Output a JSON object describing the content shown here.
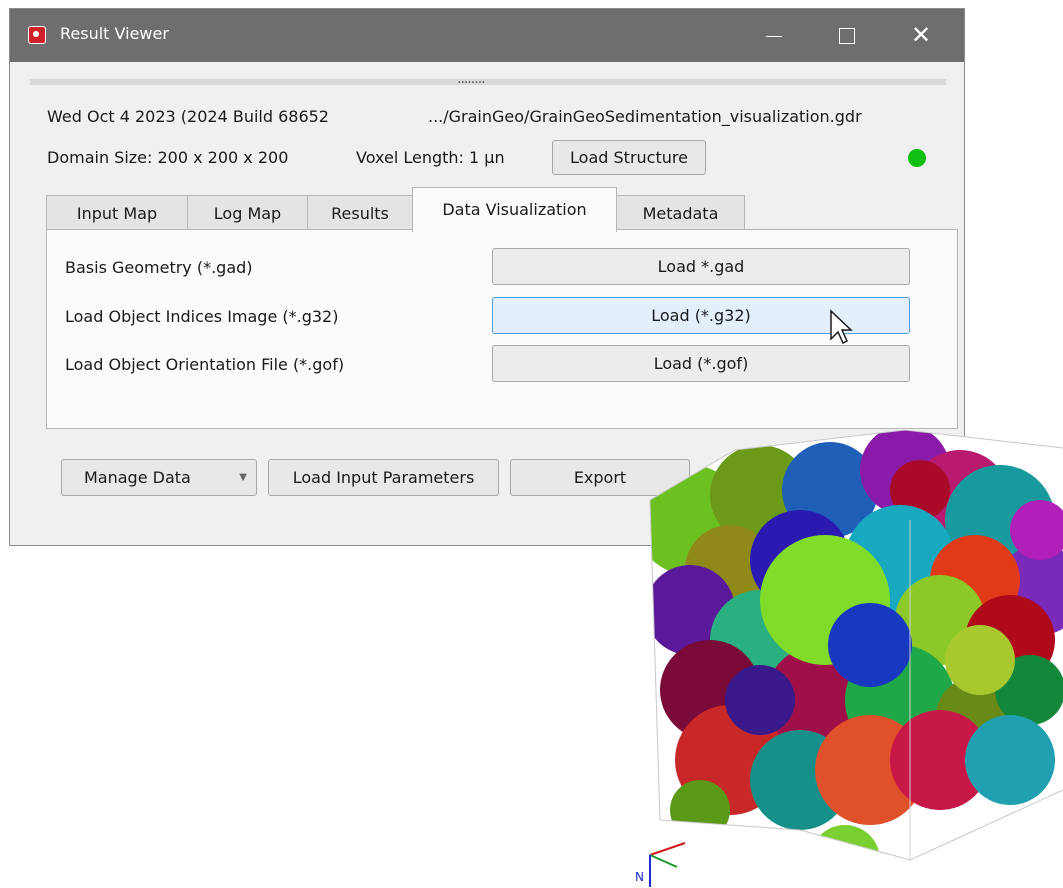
{
  "window": {
    "title": "Result Viewer",
    "controls": {
      "minimize": "minimize",
      "maximize": "maximize",
      "close": "✕"
    }
  },
  "splitter": {
    "handle": "........"
  },
  "info": {
    "build": "Wed Oct 4 2023 (2024 Build 68652",
    "file_path": ".../GrainGeo/GrainGeoSedimentation_visualization.gdr",
    "domain_size": "Domain Size: 200 x 200 x 200",
    "voxel_length": "Voxel Length: 1 µn",
    "load_structure_label": "Load Structure",
    "status_color": "#10c010"
  },
  "tabs": [
    {
      "label": "Input Map",
      "active": false
    },
    {
      "label": "Log Map",
      "active": false
    },
    {
      "label": "Results",
      "active": false
    },
    {
      "label": "Data Visualization",
      "active": true
    },
    {
      "label": "Metadata",
      "active": false
    }
  ],
  "data_visualization": {
    "rows": [
      {
        "label": "Basis Geometry (*.gad)",
        "button": "Load *.gad"
      },
      {
        "label": "Load Object Indices Image (*.g32)",
        "button": "Load (*.g32)",
        "hovered": true
      },
      {
        "label": "Load Object Orientation File (*.gof)",
        "button": "Load (*.gof)"
      }
    ]
  },
  "bottom_buttons": {
    "manage_data": "Manage Data",
    "load_input_parameters": "Load Input Parameters",
    "export": "Export"
  },
  "axes_gizmo": {
    "axis_label": "N"
  }
}
